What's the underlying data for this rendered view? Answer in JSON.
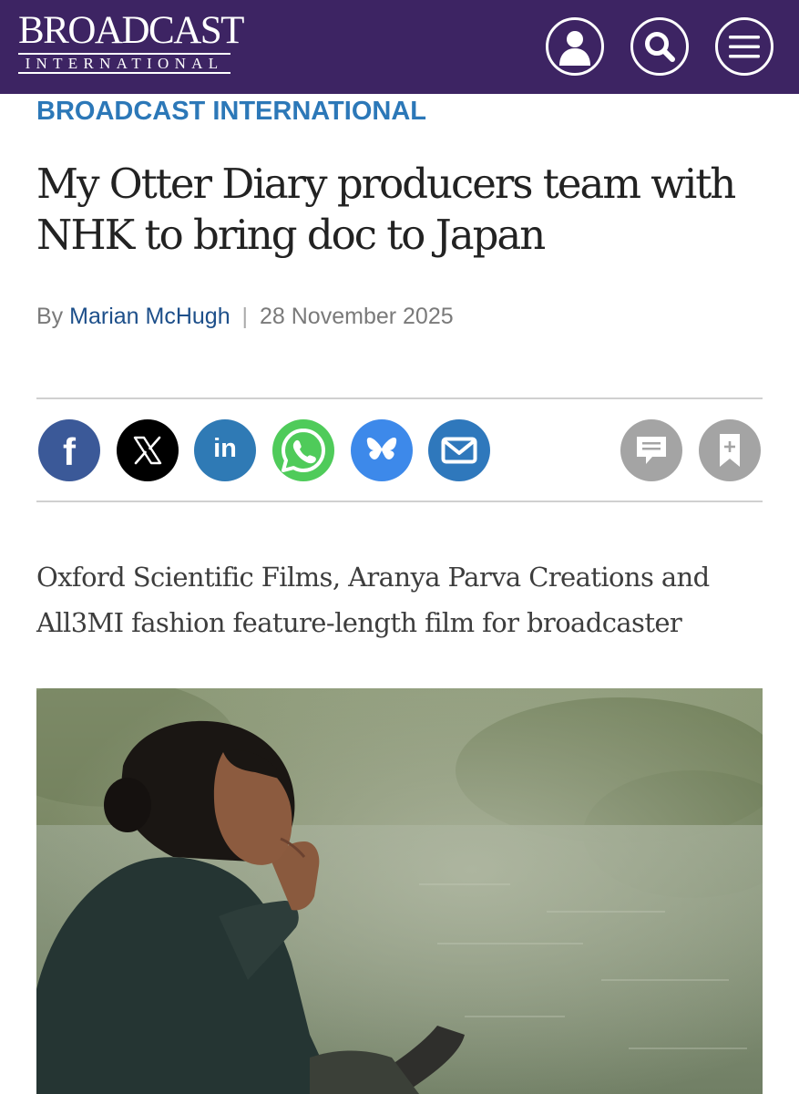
{
  "header": {
    "logo_main": "BROADCAST",
    "logo_sub": "INTERNATIONAL",
    "icons": [
      "account-icon",
      "search-icon",
      "menu-icon"
    ],
    "background_color": "#3d2463"
  },
  "article": {
    "section": "BROADCAST INTERNATIONAL",
    "headline": "My Otter Diary producers team with NHK to bring doc to Japan",
    "byline_prefix": "By",
    "author": "Marian McHugh",
    "separator": "|",
    "date": "28 November 2025",
    "standfirst": "Oxford Scientific Films, Aranya Parva Creations and All3MI fashion feature-length film for broadcaster"
  },
  "share_buttons": [
    {
      "icon": "facebook-icon",
      "color": "#3b5998"
    },
    {
      "icon": "x-icon",
      "color": "#000000"
    },
    {
      "icon": "linkedin-icon",
      "color": "#2f7ab5"
    },
    {
      "icon": "whatsapp-icon",
      "color": "#4fcb5a"
    },
    {
      "icon": "bluesky-icon",
      "color": "#3d89ea"
    },
    {
      "icon": "email-icon",
      "color": "#2f78bc"
    },
    {
      "icon": "comment-icon",
      "color": "#a4a4a4"
    },
    {
      "icon": "bookmark-icon",
      "color": "#a4a4a4"
    }
  ],
  "colors": {
    "section_label": "#2c78b8",
    "author_link": "#1d4f8a",
    "headline_text": "#222222"
  },
  "hero_image": {
    "subject": "woman sitting by a misty lake, hand at her mouth, holding a notebook"
  }
}
